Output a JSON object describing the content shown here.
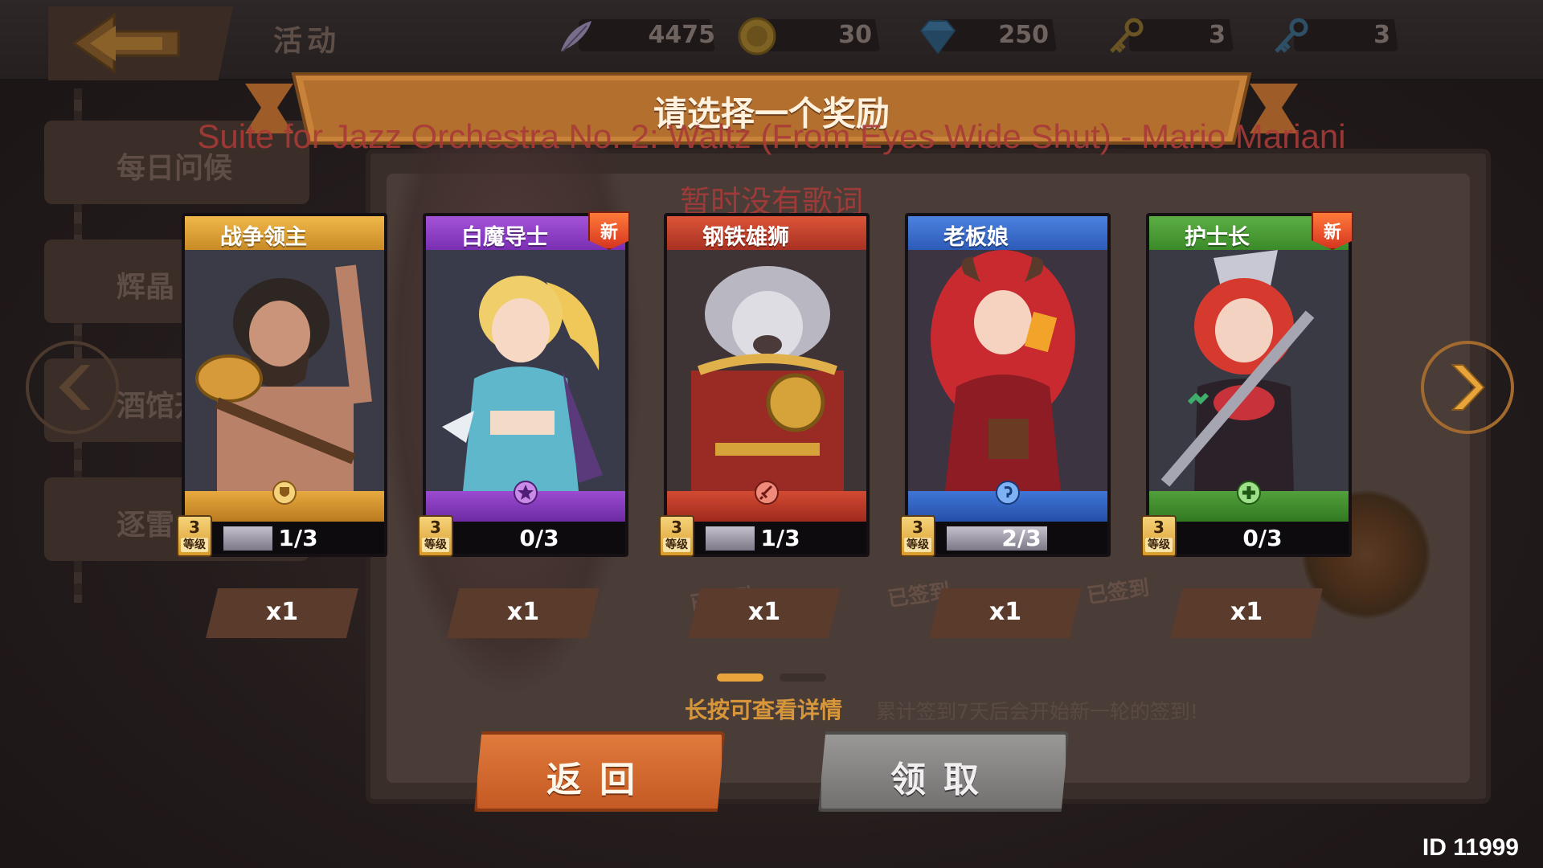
{
  "header": {
    "title": "活动",
    "resources": [
      {
        "icon": "feather-icon",
        "value": "4475"
      },
      {
        "icon": "gold-coin-icon",
        "value": "30"
      },
      {
        "icon": "diamond-icon",
        "value": "250"
      },
      {
        "icon": "gold-key-icon",
        "value": "3"
      },
      {
        "icon": "blue-key-icon",
        "value": "3"
      }
    ]
  },
  "sidebar": {
    "items": [
      {
        "label": "每日问候"
      },
      {
        "label": "辉晶"
      },
      {
        "label": "酒馆开"
      },
      {
        "label": "逐雷"
      }
    ]
  },
  "background": {
    "signed_labels": [
      "已签到",
      "已签到",
      "已签到"
    ]
  },
  "dialog": {
    "title": "请选择一个奖励",
    "music_overlay": "Suite for Jazz Orchestra No. 2: Waltz (From Eyes Wide Shut) - Mario Mariani",
    "lyrics_overlay": "暂时没有歌词",
    "cards": [
      {
        "name": "战争领主",
        "level": "3",
        "level_label": "等级",
        "progress": "1/3",
        "progress_ratio": 0.33,
        "quantity": "x1",
        "is_new": false,
        "faction": "gold",
        "class_icon": "shield-icon"
      },
      {
        "name": "白魔导士",
        "level": "3",
        "level_label": "等级",
        "progress": "0/3",
        "progress_ratio": 0,
        "quantity": "x1",
        "is_new": true,
        "new_label": "新",
        "faction": "purple",
        "class_icon": "star-icon"
      },
      {
        "name": "钢铁雄狮",
        "level": "3",
        "level_label": "等级",
        "progress": "1/3",
        "progress_ratio": 0.33,
        "quantity": "x1",
        "is_new": false,
        "faction": "red",
        "class_icon": "sword-icon"
      },
      {
        "name": "老板娘",
        "level": "3",
        "level_label": "等级",
        "progress": "2/3",
        "progress_ratio": 0.67,
        "quantity": "x1",
        "is_new": false,
        "faction": "blue",
        "class_icon": "magic-icon"
      },
      {
        "name": "护士长",
        "level": "3",
        "level_label": "等级",
        "progress": "0/3",
        "progress_ratio": 0,
        "quantity": "x1",
        "is_new": true,
        "new_label": "新",
        "faction": "green",
        "class_icon": "heal-icon"
      }
    ],
    "hint": "长按可查看详情",
    "hint_secondary": "累计签到7天后会开始新一轮的签到!",
    "back_button": "返回",
    "claim_button": "领取"
  },
  "footer": {
    "player_id": "ID 11999"
  },
  "colors": {
    "gold": "#e0a53a",
    "purple": "#8a3fc4",
    "red": "#c9402e",
    "blue": "#3b6fd1",
    "green": "#4e9a3a",
    "accent_orange": "#d8963a"
  }
}
